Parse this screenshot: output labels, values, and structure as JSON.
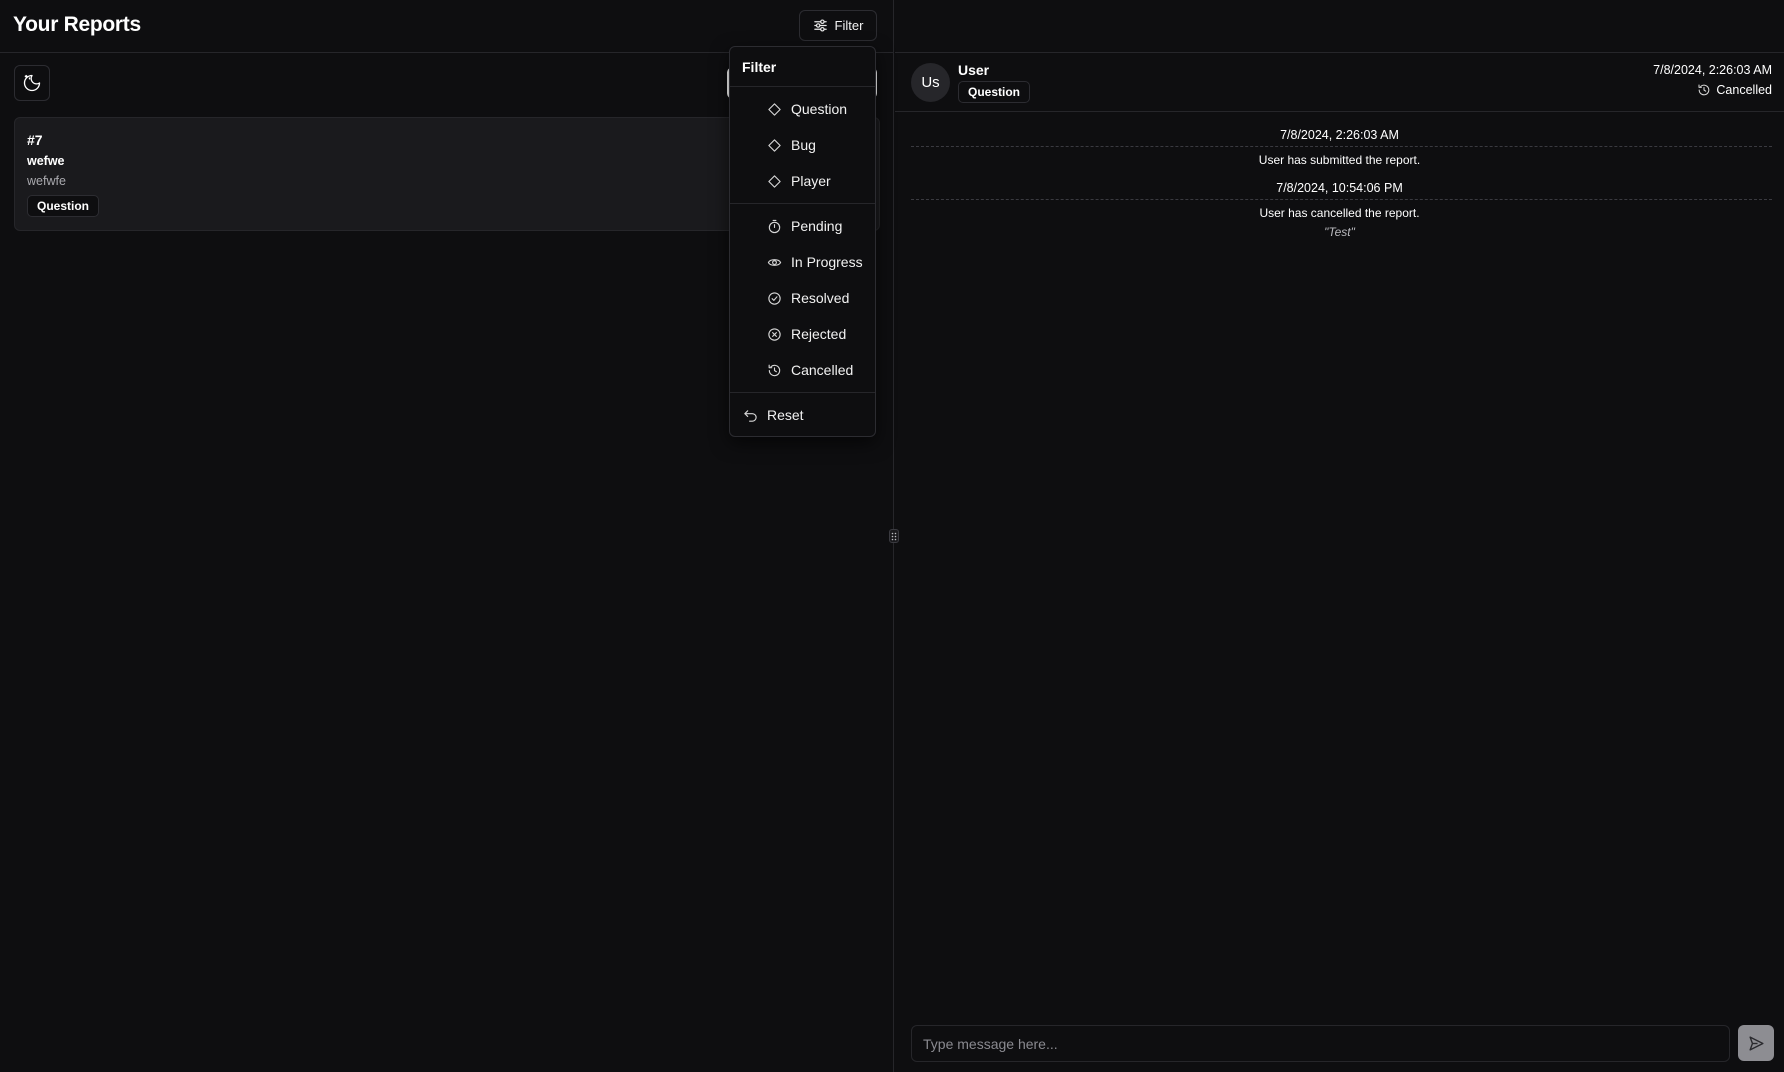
{
  "header": {
    "title": "Your Reports",
    "filter_label": "Filter"
  },
  "reports": [
    {
      "id": "#7",
      "title": "wefwe",
      "description": "wefwfe",
      "type": "Question"
    }
  ],
  "filter_menu": {
    "title": "Filter",
    "types": [
      "Question",
      "Bug",
      "Player"
    ],
    "statuses": [
      {
        "label": "Pending",
        "icon": "timer-icon"
      },
      {
        "label": "In Progress",
        "icon": "eye-icon"
      },
      {
        "label": "Resolved",
        "icon": "check-circle-icon"
      },
      {
        "label": "Rejected",
        "icon": "x-circle-icon"
      },
      {
        "label": "Cancelled",
        "icon": "history-icon"
      }
    ],
    "reset_label": "Reset"
  },
  "conversation": {
    "avatar_initials": "Us",
    "user_name": "User",
    "type": "Question",
    "date": "7/8/2024, 2:26:03 AM",
    "status": "Cancelled",
    "events": [
      {
        "date": "7/8/2024, 2:26:03 AM",
        "text": "User has submitted the report.",
        "reason": ""
      },
      {
        "date": "7/8/2024, 10:54:06 PM",
        "text": "User has cancelled the report.",
        "reason": "\"Test\""
      }
    ],
    "input_placeholder": "Type message here..."
  },
  "colors": {
    "background": "#0e0e10",
    "card": "#1a1a1d",
    "border": "#26262a",
    "send_button": "#8d8d92"
  }
}
